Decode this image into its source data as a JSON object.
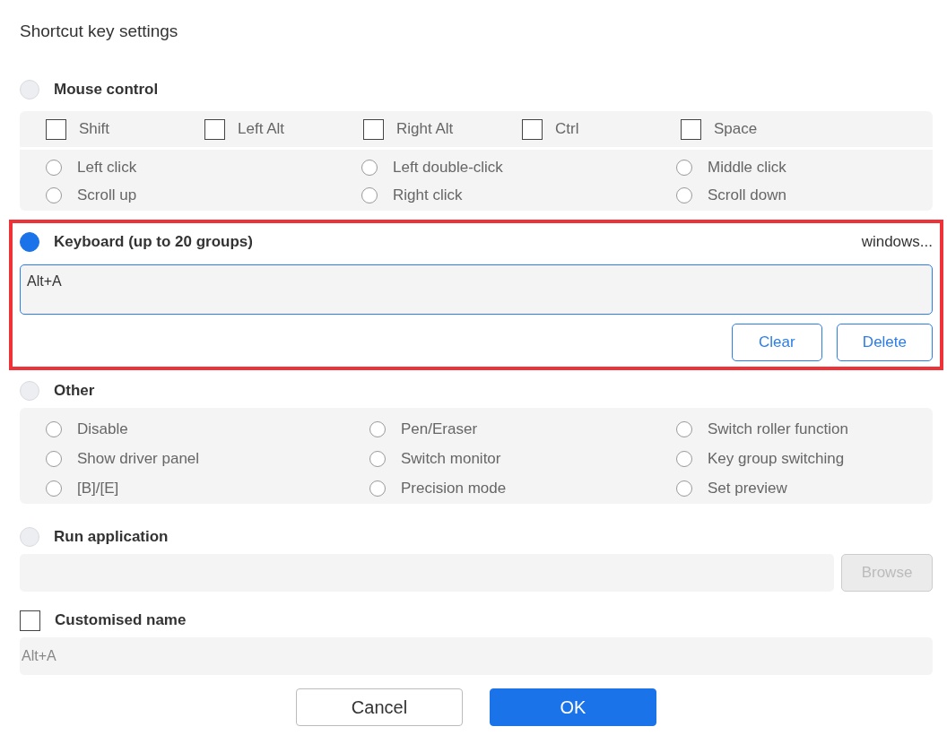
{
  "dialog": {
    "title": "Shortcut key settings"
  },
  "mouse": {
    "label": "Mouse control",
    "selected": false,
    "modifiers": [
      {
        "label": "Shift",
        "checked": false
      },
      {
        "label": "Left Alt",
        "checked": false
      },
      {
        "label": "Right Alt",
        "checked": false
      },
      {
        "label": "Ctrl",
        "checked": false
      },
      {
        "label": "Space",
        "checked": false
      }
    ],
    "actions": [
      {
        "label": "Left click",
        "selected": false
      },
      {
        "label": "Left double-click",
        "selected": false
      },
      {
        "label": "Middle click",
        "selected": false
      },
      {
        "label": "Scroll up",
        "selected": false
      },
      {
        "label": "Right click",
        "selected": false
      },
      {
        "label": "Scroll down",
        "selected": false
      }
    ]
  },
  "keyboard": {
    "label": "Keyboard (up to 20 groups)",
    "selected": true,
    "system": "windows...",
    "value": "Alt+A",
    "buttons": [
      "Clear",
      "Delete"
    ]
  },
  "other": {
    "label": "Other",
    "selected": false,
    "actions": [
      {
        "label": "Disable",
        "selected": false
      },
      {
        "label": "Pen/Eraser",
        "selected": false
      },
      {
        "label": "Switch roller function",
        "selected": false
      },
      {
        "label": "Show driver panel",
        "selected": false
      },
      {
        "label": "Switch monitor",
        "selected": false
      },
      {
        "label": "Key group switching",
        "selected": false
      },
      {
        "label": "[B]/[E]",
        "selected": false
      },
      {
        "label": "Precision mode",
        "selected": false
      },
      {
        "label": "Set preview",
        "selected": false
      }
    ]
  },
  "run_application": {
    "label": "Run application",
    "selected": false,
    "browse": {
      "label": "Browse",
      "disabled": true
    }
  },
  "customised_name": {
    "label": "Customised name",
    "checked": false,
    "value": "Alt+A"
  },
  "buttons": [
    {
      "label": "Cancel",
      "kind": "secondary"
    },
    {
      "label": "OK",
      "kind": "primary"
    }
  ]
}
